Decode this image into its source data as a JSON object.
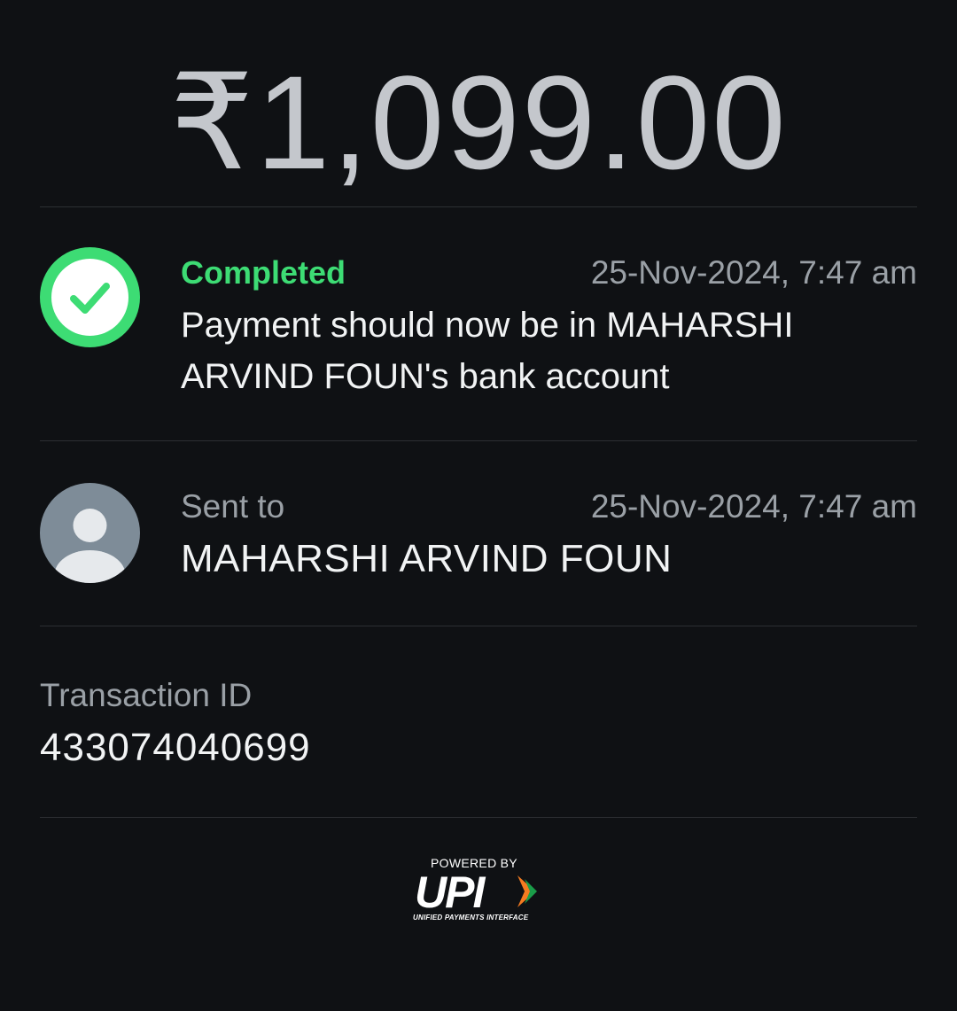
{
  "payment": {
    "amount": "₹1,099.00"
  },
  "status": {
    "label": "Completed",
    "timestamp": "25-Nov-2024, 7:47 am",
    "message": "Payment should now be in MAHARSHI ARVIND FOUN's bank account",
    "icon": "check-circle-icon",
    "color": "#3ddc74"
  },
  "recipient": {
    "label": "Sent to",
    "timestamp": "25-Nov-2024, 7:47 am",
    "name": "MAHARSHI ARVIND FOUN",
    "icon": "person-avatar-icon"
  },
  "transaction": {
    "label": "Transaction ID",
    "id": "433074040699"
  },
  "footer": {
    "powered_by": "POWERED BY",
    "brand": "UPI",
    "brand_subtitle": "UNIFIED PAYMENTS INTERFACE"
  }
}
